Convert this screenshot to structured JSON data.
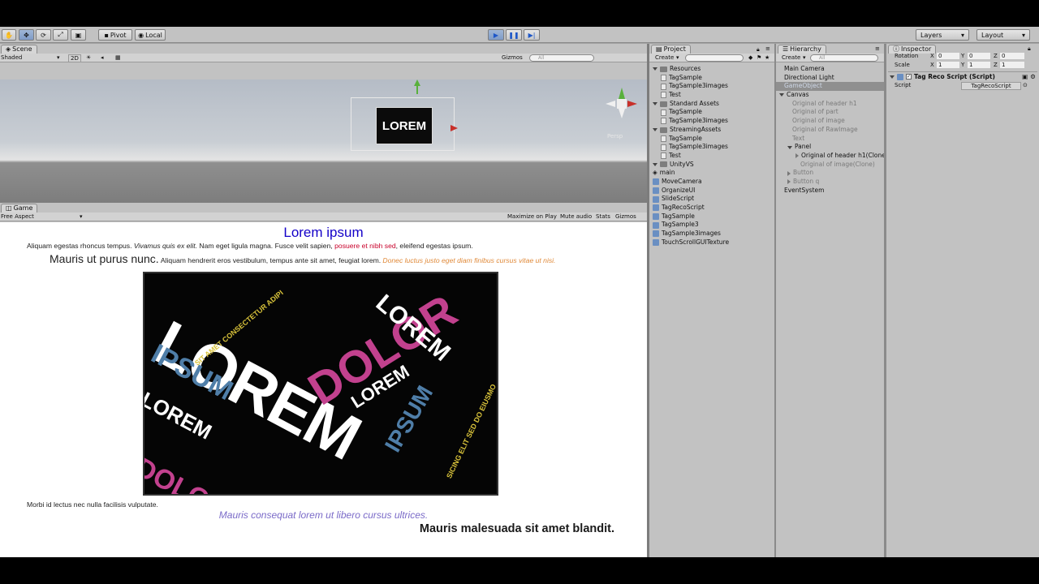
{
  "toolbar": {
    "pivot": "Pivot",
    "local": "Local",
    "layers": "Layers",
    "layout": "Layout"
  },
  "scene": {
    "tab": "Scene",
    "shading": "Shaded",
    "mode_2d": "2D",
    "gizmos": "Gizmos",
    "search_placeholder": "All",
    "persp": "Persp",
    "preview_word": "LOREM"
  },
  "game": {
    "tab": "Game",
    "aspect": "Free Aspect",
    "buttons": [
      "Maximize on Play",
      "Mute audio",
      "Stats",
      "Gizmos"
    ],
    "title": "Lorem ipsum",
    "line1": {
      "a": "Aliquam egestas rhoncus tempus.",
      "b": "Vivamus quis ex elit.",
      "c": "Nam eget ligula magna. Fusce velit sapien,",
      "d": "posuere et nibh sed",
      "e": ", eleifend egestas ipsum."
    },
    "line2": {
      "a": "Mauris ut purus nunc.",
      "b": "Aliquam hendrerit eros vestibulum, tempus ante sit amet, feugiat lorem.",
      "c": "Donec luctus justo eget diam finibus cursus vitae ut nisi."
    },
    "image_words": [
      "LOREM",
      "IPSUM",
      "DOLOR",
      "LOREM",
      "DOLOR",
      "LOREM",
      "IPSUM",
      "LOREM",
      "SIT AMET CONSECTETUR ADIPI",
      "SICING ELIT SED DO EIUSMO"
    ],
    "line3": "Morbi id lectus nec nulla facilisis vulputate.",
    "line4": "Mauris consequat lorem ut libero cursus ultrices.",
    "line5": "Mauris malesuada sit amet blandit."
  },
  "project": {
    "tab": "Project",
    "create": "Create",
    "items": [
      {
        "label": "Resources",
        "type": "folder",
        "indent": 0
      },
      {
        "label": "TagSample",
        "type": "doc",
        "indent": 1
      },
      {
        "label": "TagSample3images",
        "type": "doc",
        "indent": 1
      },
      {
        "label": "Test",
        "type": "doc",
        "indent": 1
      },
      {
        "label": "Standard Assets",
        "type": "folder",
        "indent": 0
      },
      {
        "label": "TagSample",
        "type": "doc",
        "indent": 1
      },
      {
        "label": "TagSample3images",
        "type": "doc",
        "indent": 1
      },
      {
        "label": "StreamingAssets",
        "type": "folder",
        "indent": 0
      },
      {
        "label": "TagSample",
        "type": "doc",
        "indent": 1
      },
      {
        "label": "TagSample3images",
        "type": "doc",
        "indent": 1
      },
      {
        "label": "Test",
        "type": "doc",
        "indent": 1
      },
      {
        "label": "UnityVS",
        "type": "folder",
        "indent": 0
      },
      {
        "label": "main",
        "type": "unity",
        "indent": 0
      },
      {
        "label": "MoveCamera",
        "type": "cs",
        "indent": 0
      },
      {
        "label": "OrganizeUI",
        "type": "cs",
        "indent": 0
      },
      {
        "label": "SlideScript",
        "type": "cs",
        "indent": 0
      },
      {
        "label": "TagRecoScript",
        "type": "cs",
        "indent": 0
      },
      {
        "label": "TagSample",
        "type": "cs",
        "indent": 0
      },
      {
        "label": "TagSample3",
        "type": "cs",
        "indent": 0
      },
      {
        "label": "TagSample3images",
        "type": "cs",
        "indent": 0
      },
      {
        "label": "TouchScrollGUITexture",
        "type": "cs",
        "indent": 0
      }
    ]
  },
  "hierarchy": {
    "tab": "Hierarchy",
    "create": "Create",
    "search_placeholder": "All",
    "items": [
      {
        "label": "Main Camera",
        "indent": 0,
        "arrow": "",
        "dim": false,
        "selected": false
      },
      {
        "label": "Directional Light",
        "indent": 0,
        "arrow": "",
        "dim": false,
        "selected": false
      },
      {
        "label": "GameObject",
        "indent": 0,
        "arrow": "",
        "dim": false,
        "selected": true
      },
      {
        "label": "Canvas",
        "indent": 0,
        "arrow": "down",
        "dim": false,
        "selected": false
      },
      {
        "label": "Original of header h1",
        "indent": 1,
        "arrow": "",
        "dim": true,
        "selected": false
      },
      {
        "label": "Original of part",
        "indent": 1,
        "arrow": "",
        "dim": true,
        "selected": false
      },
      {
        "label": "Original of image",
        "indent": 1,
        "arrow": "",
        "dim": true,
        "selected": false
      },
      {
        "label": "Original of RawImage",
        "indent": 1,
        "arrow": "",
        "dim": true,
        "selected": false
      },
      {
        "label": "Text",
        "indent": 1,
        "arrow": "",
        "dim": true,
        "selected": false
      },
      {
        "label": "Panel",
        "indent": 1,
        "arrow": "down",
        "dim": false,
        "selected": false
      },
      {
        "label": "Original of header h1(Clone",
        "indent": 2,
        "arrow": "right",
        "dim": false,
        "selected": false
      },
      {
        "label": "Original of image(Clone)",
        "indent": 2,
        "arrow": "",
        "dim": true,
        "selected": false
      },
      {
        "label": "Button",
        "indent": 1,
        "arrow": "right",
        "dim": true,
        "selected": false
      },
      {
        "label": "Button q",
        "indent": 1,
        "arrow": "right",
        "dim": true,
        "selected": false
      },
      {
        "label": "EventSystem",
        "indent": 0,
        "arrow": "",
        "dim": false,
        "selected": false
      }
    ]
  },
  "inspector": {
    "tab": "Inspector",
    "rotation_label": "Rotation",
    "scale_label": "Scale",
    "x": "X",
    "y": "Y",
    "z": "Z",
    "rotation": [
      "0",
      "0",
      "0"
    ],
    "scale": [
      "1",
      "1",
      "1"
    ],
    "component": "Tag Reco Script (Script)",
    "script_label": "Script",
    "script_value": "TagRecoScript"
  },
  "colors": {
    "title_blue": "#1400c8",
    "red": "#c8002a",
    "orange": "#e08a3a",
    "purple": "#7a6ac8",
    "pink": "#c2418e",
    "steel": "#4f7ea8",
    "yellow": "#d8c23a"
  }
}
